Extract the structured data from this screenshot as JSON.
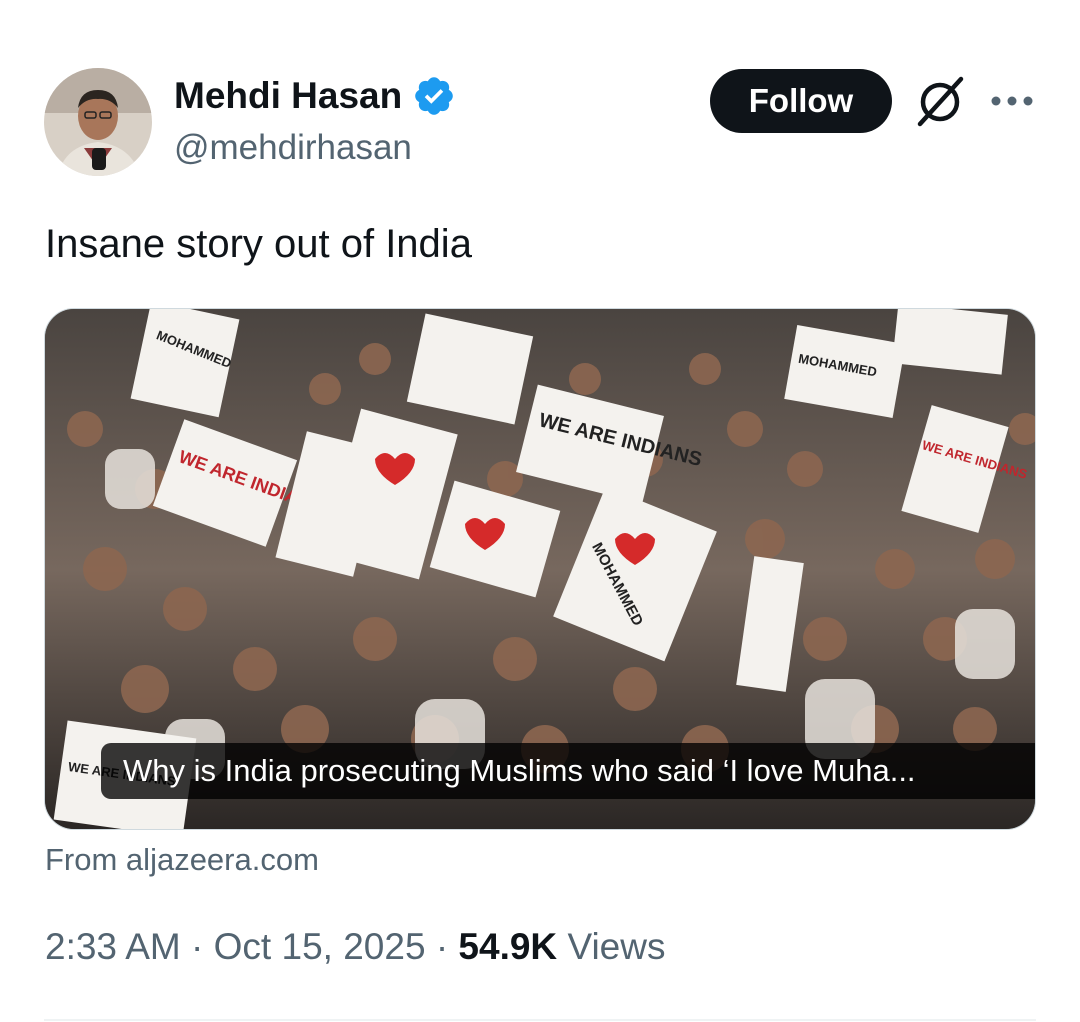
{
  "author": {
    "name": "Mehdi Hasan",
    "handle": "@mehdirhasan",
    "verified": true
  },
  "actions": {
    "follow_label": "Follow",
    "grok_icon": "grok-icon",
    "more_icon": "more-icon"
  },
  "tweet": {
    "text": "Insane story out of India"
  },
  "link_card": {
    "title": "Why is India prosecuting Muslims who said ‘I love Muha...",
    "source": "From aljazeera.com",
    "image_signs": [
      "MOHAMMED",
      "MOHAMMED",
      "WE ARE INDIANS",
      "WE ARE INDIANS",
      "WE ARE INDIANS",
      "MOHAMMED",
      "WE ARE INDIANS"
    ]
  },
  "meta": {
    "time": "2:33 AM",
    "separator": "·",
    "date": "Oct 15, 2025",
    "views_count": "54.9K",
    "views_label": "Views"
  },
  "colors": {
    "verified_blue": "#1d9bf0",
    "button_black": "#0f1419",
    "secondary_text": "#536471"
  }
}
